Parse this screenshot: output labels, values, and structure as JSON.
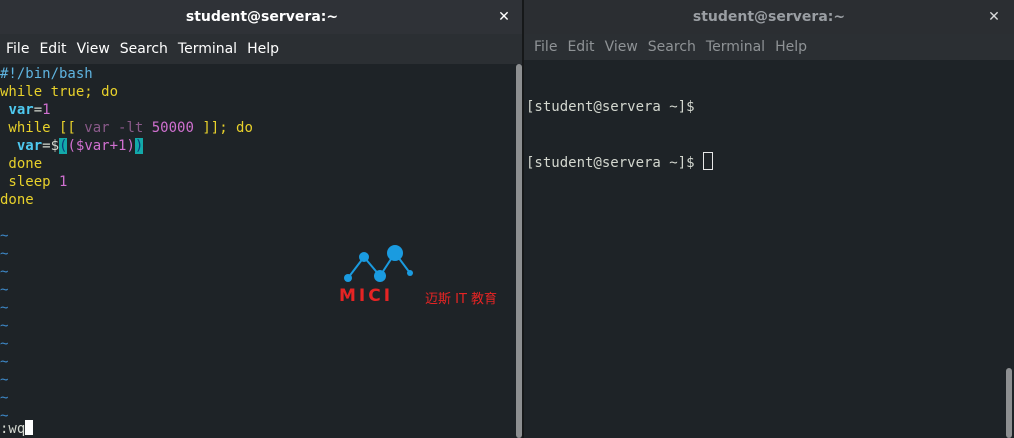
{
  "left_window": {
    "title": "student@servera:~",
    "close_glyph": "✕",
    "menu": [
      "File",
      "Edit",
      "View",
      "Search",
      "Terminal",
      "Help"
    ],
    "lines": [
      {
        "tokens": [
          {
            "t": "#!/bin/bash",
            "c": "c-comment"
          }
        ]
      },
      {
        "tokens": [
          {
            "t": "while true; do",
            "c": "c-kw"
          }
        ]
      },
      {
        "tokens": [
          {
            "t": " ",
            "c": "c-text"
          },
          {
            "t": "var",
            "c": "c-var"
          },
          {
            "t": "=",
            "c": "c-text"
          },
          {
            "t": "1",
            "c": "c-num"
          }
        ]
      },
      {
        "tokens": [
          {
            "t": " while [[ ",
            "c": "c-kw"
          },
          {
            "t": "var",
            "c": "c-dim"
          },
          {
            "t": " -lt ",
            "c": "c-dim"
          },
          {
            "t": "50000",
            "c": "c-num"
          },
          {
            "t": " ]]; do",
            "c": "c-kw"
          }
        ]
      },
      {
        "tokens": [
          {
            "t": "  ",
            "c": "c-text"
          },
          {
            "t": "var",
            "c": "c-var"
          },
          {
            "t": "=$",
            "c": "c-text"
          },
          {
            "t": "(",
            "c": "c-paren-hl"
          },
          {
            "t": "(",
            "c": "c-num"
          },
          {
            "t": "$var",
            "c": "c-num"
          },
          {
            "t": "+1",
            "c": "c-num"
          },
          {
            "t": ")",
            "c": "c-num"
          },
          {
            "t": ")",
            "c": "c-paren-hl"
          }
        ]
      },
      {
        "tokens": [
          {
            "t": " done",
            "c": "c-kw"
          }
        ]
      },
      {
        "tokens": [
          {
            "t": " sleep ",
            "c": "c-kw"
          },
          {
            "t": "1",
            "c": "c-num"
          }
        ]
      },
      {
        "tokens": [
          {
            "t": "done",
            "c": "c-kw"
          }
        ]
      },
      {
        "tokens": [
          {
            "t": "",
            "c": "c-text"
          }
        ]
      },
      {
        "tokens": [
          {
            "t": "~",
            "c": "tilde"
          }
        ]
      },
      {
        "tokens": [
          {
            "t": "~",
            "c": "tilde"
          }
        ]
      },
      {
        "tokens": [
          {
            "t": "~",
            "c": "tilde"
          }
        ]
      },
      {
        "tokens": [
          {
            "t": "~",
            "c": "tilde"
          }
        ]
      },
      {
        "tokens": [
          {
            "t": "~",
            "c": "tilde"
          }
        ]
      },
      {
        "tokens": [
          {
            "t": "~",
            "c": "tilde"
          }
        ]
      },
      {
        "tokens": [
          {
            "t": "~",
            "c": "tilde"
          }
        ]
      },
      {
        "tokens": [
          {
            "t": "~",
            "c": "tilde"
          }
        ]
      },
      {
        "tokens": [
          {
            "t": "~",
            "c": "tilde"
          }
        ]
      },
      {
        "tokens": [
          {
            "t": "~",
            "c": "tilde"
          }
        ]
      },
      {
        "tokens": [
          {
            "t": "~",
            "c": "tilde"
          }
        ]
      }
    ],
    "command_line": ":wq"
  },
  "right_window": {
    "title": "student@servera:~",
    "close_glyph": "✕",
    "menu": [
      "File",
      "Edit",
      "View",
      "Search",
      "Terminal",
      "Help"
    ],
    "lines": [
      "[student@servera ~]$",
      "[student@servera ~]$ "
    ]
  },
  "watermark": {
    "logo_text": "MICI",
    "sub_text": "迈斯 IT 教育",
    "color": "#e52424",
    "accent": "#1a9be0"
  }
}
